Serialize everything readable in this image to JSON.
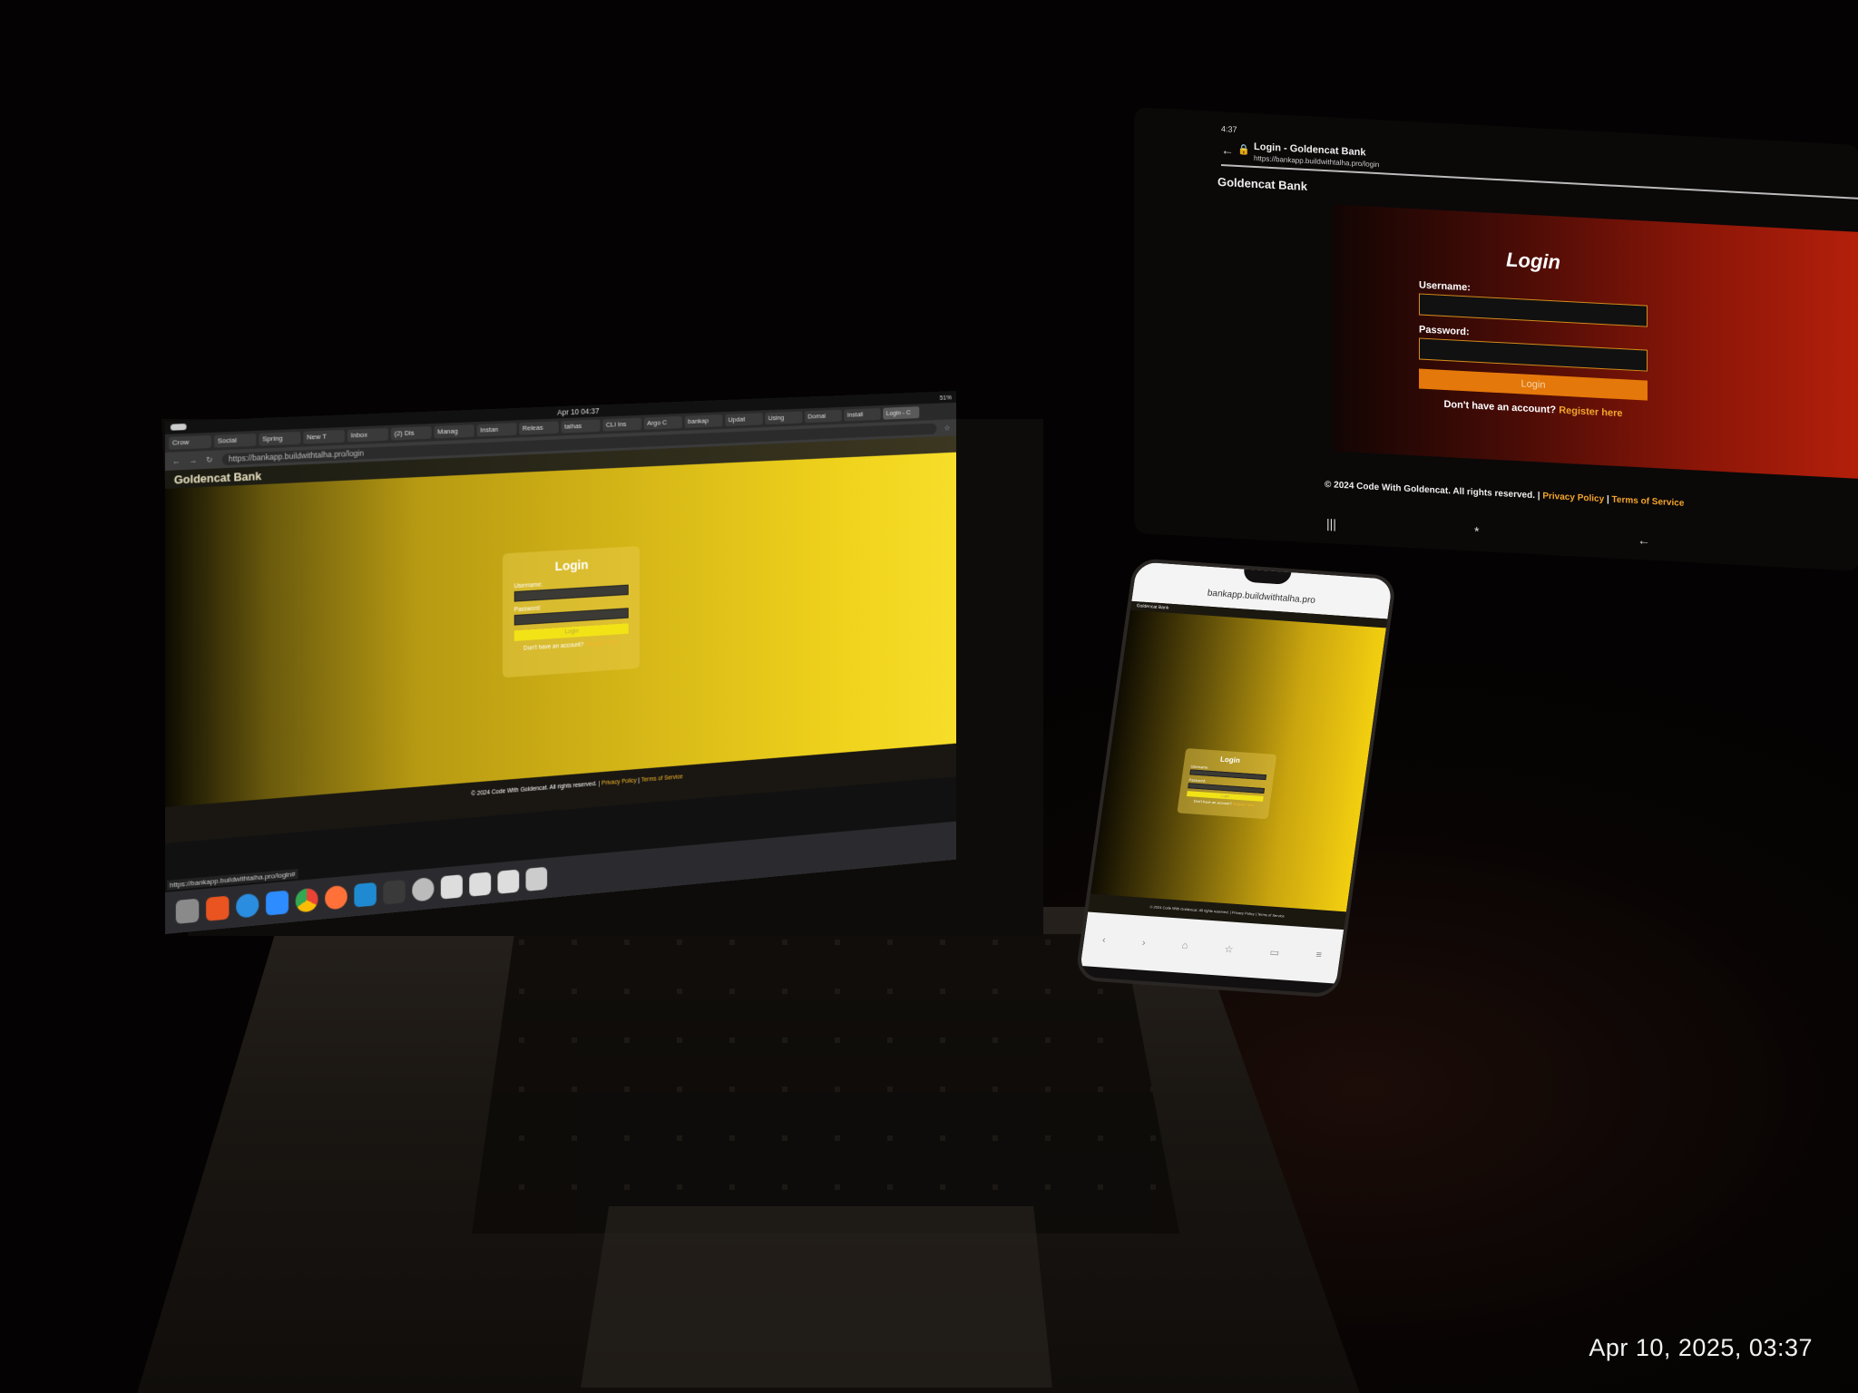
{
  "photo": {
    "timestamp": "Apr 10, 2025, 03:37"
  },
  "laptop": {
    "system_clock": "Apr 10 04:37",
    "battery": "51%",
    "tabs": [
      "Crow",
      "Social",
      "Spring",
      "New T",
      "Inbox",
      "(2) Dis",
      "Manag",
      "Instan",
      "Releas",
      "talhas",
      "CLI Ins",
      "Argo C",
      "bankap",
      "Updat",
      "Using",
      "Domai",
      "Install",
      "Login - C"
    ],
    "url": "https://bankapp.buildwithtalha.pro/login",
    "status_url": "https://bankapp.buildwithtalha.pro/login#",
    "brand": "Goldencat Bank",
    "login": {
      "title": "Login",
      "username_label": "Username:",
      "password_label": "Password:",
      "button": "Login",
      "register_prompt": "Don't have an account?",
      "register_link": "Register here"
    },
    "footer": {
      "copyright": "© 2024 Code With Goldencat. All rights reserved. |",
      "privacy": "Privacy Policy",
      "sep": "|",
      "terms": "Terms of Service"
    },
    "dock_apps": [
      "files-icon",
      "app-center-icon",
      "help-icon",
      "zoom-icon",
      "chrome-icon",
      "firefox-icon",
      "vscode-icon",
      "terminal-icon",
      "settings-icon",
      "text-editor-icon",
      "document-icon",
      "document-icon",
      "trash-icon"
    ],
    "colors": {
      "page_gold": "#f0d31c",
      "button": "#f2e317",
      "link": "#f3b62b"
    }
  },
  "tablet": {
    "status_time": "4:37",
    "tab_title": "Login - Goldencat Bank",
    "url": "https://bankapp.buildwithtalha.pro/login",
    "brand": "Goldencat Bank",
    "login": {
      "title": "Login",
      "username_label": "Username:",
      "password_label": "Password:",
      "button": "Login",
      "register_prompt": "Don't have an account?",
      "register_link": "Register here"
    },
    "footer": {
      "copyright": "© 2024 Code With Goldencat. All rights reserved. |",
      "privacy": "Privacy Policy",
      "sep": "|",
      "terms": "Terms of Service"
    },
    "nav": {
      "recents": "|||",
      "home": "*",
      "back": "←"
    },
    "colors": {
      "page_red": "#b4200a",
      "button": "#e4780a",
      "link": "#f3a52b"
    }
  },
  "phone": {
    "url": "bankapp.buildwithtalha.pro",
    "brand": "Goldencat Bank",
    "login": {
      "title": "Login",
      "username_label": "Username:",
      "password_label": "Password:",
      "button": "Login",
      "register_prompt": "Don't have an account?",
      "register_link": "Register here"
    },
    "footer": "© 2024 Code With Goldencat. All rights reserved. | Privacy Policy | Terms of Service",
    "nav": [
      "‹",
      "›",
      "⌂",
      "☆",
      "▭",
      "≡"
    ],
    "colors": {
      "page_gold": "#f3cf10"
    }
  }
}
